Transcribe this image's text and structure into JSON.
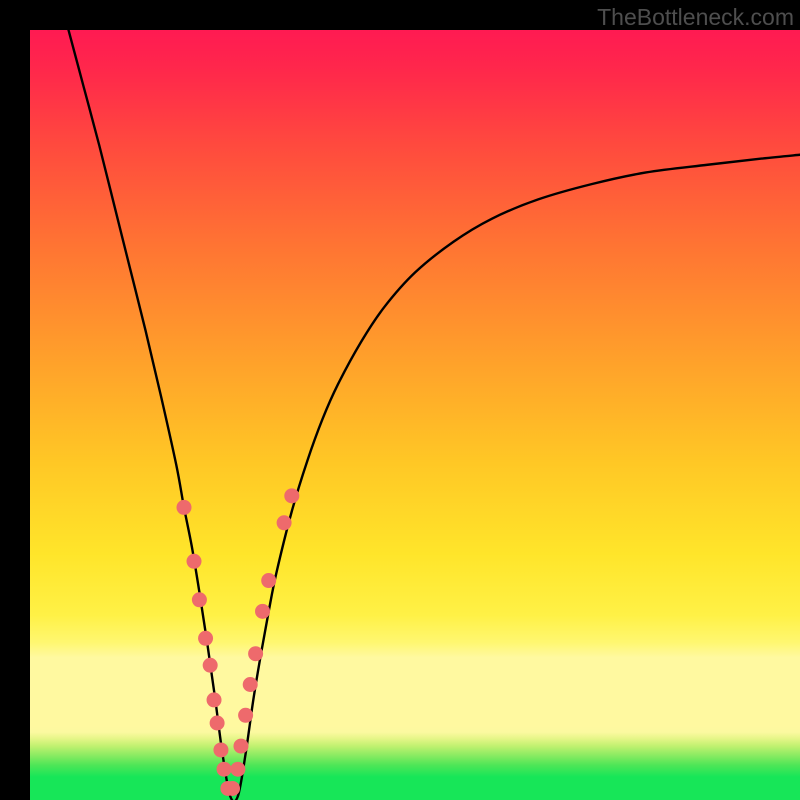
{
  "watermark": "TheBottleneck.com",
  "colors": {
    "frame": "#000000",
    "curve_stroke": "#000000",
    "dot_fill": "#ee6a6c",
    "green_band": "#17e658"
  },
  "gradient_stops": [
    {
      "offset": 0.0,
      "color": "#ff1a52"
    },
    {
      "offset": 0.06,
      "color": "#ff2a4a"
    },
    {
      "offset": 0.15,
      "color": "#ff4a3e"
    },
    {
      "offset": 0.28,
      "color": "#ff7433"
    },
    {
      "offset": 0.42,
      "color": "#ff9e2b"
    },
    {
      "offset": 0.56,
      "color": "#ffc725"
    },
    {
      "offset": 0.68,
      "color": "#ffe52a"
    },
    {
      "offset": 0.76,
      "color": "#fff146"
    },
    {
      "offset": 0.795,
      "color": "#fff770"
    },
    {
      "offset": 0.815,
      "color": "#fff9a0"
    },
    {
      "offset": 0.905,
      "color": "#fff9a0"
    },
    {
      "offset": 0.912,
      "color": "#fbf9a0"
    },
    {
      "offset": 0.92,
      "color": "#e6f688"
    },
    {
      "offset": 0.93,
      "color": "#c0f170"
    },
    {
      "offset": 0.942,
      "color": "#8aeb62"
    },
    {
      "offset": 0.955,
      "color": "#4de657"
    },
    {
      "offset": 0.97,
      "color": "#17e658"
    },
    {
      "offset": 1.0,
      "color": "#17e658"
    }
  ],
  "chart_data": {
    "type": "line",
    "title": "",
    "xlabel": "",
    "ylabel": "",
    "xlim": [
      0,
      100
    ],
    "ylim": [
      0,
      100
    ],
    "series": [
      {
        "name": "bottleneck-curve",
        "x": [
          5,
          7,
          9,
          11,
          13,
          15,
          17,
          19,
          20,
          21,
          22,
          23,
          24,
          25,
          26,
          27,
          28,
          29,
          30,
          31,
          32,
          34,
          36,
          38,
          40,
          43,
          46,
          50,
          55,
          60,
          66,
          73,
          80,
          88,
          95,
          100
        ],
        "y": [
          100,
          92.5,
          85,
          77,
          69,
          61,
          52.5,
          43.5,
          38,
          33,
          27,
          20.5,
          13.5,
          6,
          0.5,
          0.5,
          6,
          13,
          19,
          24.5,
          29.5,
          37.5,
          44,
          49.5,
          54,
          59.5,
          64,
          68.5,
          72.5,
          75.5,
          78,
          80,
          81.5,
          82.5,
          83.3,
          83.8
        ]
      }
    ],
    "dots": [
      {
        "x": 20.0,
        "y": 38.0
      },
      {
        "x": 21.3,
        "y": 31.0
      },
      {
        "x": 22.0,
        "y": 26.0
      },
      {
        "x": 22.8,
        "y": 21.0
      },
      {
        "x": 23.4,
        "y": 17.5
      },
      {
        "x": 23.9,
        "y": 13.0
      },
      {
        "x": 24.3,
        "y": 10.0
      },
      {
        "x": 24.8,
        "y": 6.5
      },
      {
        "x": 25.2,
        "y": 4.0
      },
      {
        "x": 25.7,
        "y": 1.5
      },
      {
        "x": 26.3,
        "y": 1.5
      },
      {
        "x": 27.0,
        "y": 4.0
      },
      {
        "x": 27.4,
        "y": 7.0
      },
      {
        "x": 28.0,
        "y": 11.0
      },
      {
        "x": 28.6,
        "y": 15.0
      },
      {
        "x": 29.3,
        "y": 19.0
      },
      {
        "x": 30.2,
        "y": 24.5
      },
      {
        "x": 31.0,
        "y": 28.5
      },
      {
        "x": 33.0,
        "y": 36.0
      },
      {
        "x": 34.0,
        "y": 39.5
      }
    ],
    "dot_radius_px": 7.5
  }
}
